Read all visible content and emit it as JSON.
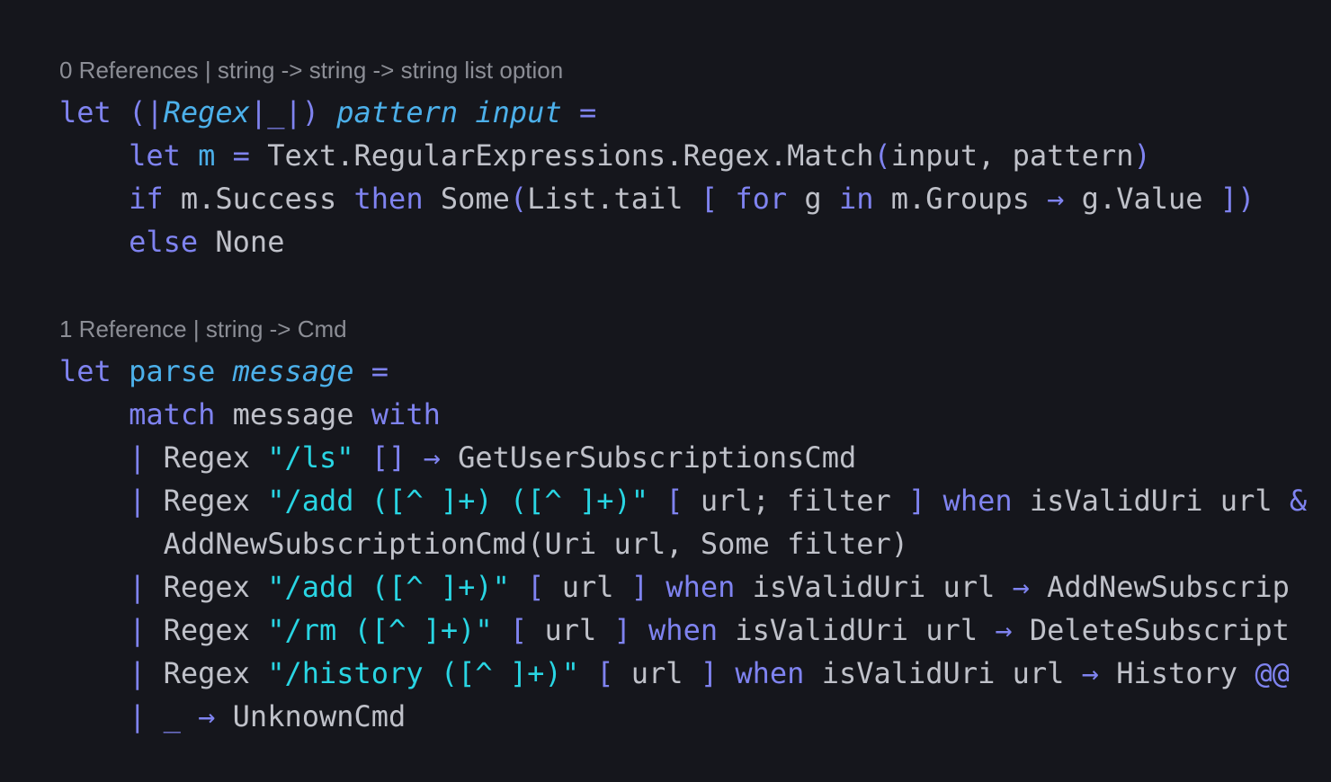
{
  "editor": {
    "code_lens": [
      "0 References | string -> string -> string list option",
      "1 Reference | string -> Cmd"
    ],
    "function1": {
      "line1": {
        "let": "let",
        "open": "(",
        "bar1": "|",
        "name": "Regex",
        "bar2": "|",
        "wild": "_",
        "bar3": "|",
        "close": ")",
        "p1": "pattern",
        "p2": "input",
        "eq": "="
      },
      "line2": {
        "let": "let",
        "var": "m",
        "eq": "=",
        "call": "Text.RegularExpressions.Regex.Match",
        "lp": "(",
        "args": "input, pattern",
        "rp": ")"
      },
      "line3": {
        "if": "if",
        "cond": "m.Success",
        "then": "then",
        "some": "Some",
        "lp": "(",
        "tail": "List.tail",
        "lb": "[",
        "for": "for",
        "g": "g",
        "in": "in",
        "groups": "m.Groups",
        "arrow": "→",
        "val": "g.Value",
        "rb": "]",
        "rp": ")"
      },
      "line4": {
        "else": "else",
        "none": "None"
      }
    },
    "function2": {
      "line1": {
        "let": "let",
        "name": "parse",
        "param": "message",
        "eq": "="
      },
      "line2": {
        "match": "match",
        "subject": "message",
        "with": "with"
      },
      "case1": {
        "pipe": "|",
        "ap": "Regex",
        "pattern": "\"/ls\"",
        "list": "[]",
        "arrow": "→",
        "result": "GetUserSubscriptionsCmd"
      },
      "case2": {
        "pipe": "|",
        "ap": "Regex",
        "pattern": "\"/add ([^ ]+) ([^ ]+)\"",
        "lb": "[",
        "vars": "url; filter",
        "rb": "]",
        "when": "when",
        "guard": "isValidUri url",
        "tail": "&"
      },
      "case2b": {
        "result": "AddNewSubscriptionCmd(Uri url, Some filter)"
      },
      "case3": {
        "pipe": "|",
        "ap": "Regex",
        "pattern": "\"/add ([^ ]+)\"",
        "lb": "[",
        "vars": "url",
        "rb": "]",
        "when": "when",
        "guard": "isValidUri url",
        "arrow": "→",
        "result": "AddNewSubscrip"
      },
      "case4": {
        "pipe": "|",
        "ap": "Regex",
        "pattern": "\"/rm ([^ ]+)\"",
        "lb": "[",
        "vars": "url",
        "rb": "]",
        "when": "when",
        "guard": "isValidUri url",
        "arrow": "→",
        "result": "DeleteSubscript"
      },
      "case5": {
        "pipe": "|",
        "ap": "Regex",
        "pattern": "\"/history ([^ ]+)\"",
        "lb": "[",
        "vars": "url",
        "rb": "]",
        "when": "when",
        "guard": "isValidUri url",
        "arrow": "→",
        "result": "History",
        "tail": "@@"
      },
      "case6": {
        "pipe": "|",
        "wild": "_",
        "arrow": "→",
        "result": "UnknownCmd"
      }
    }
  },
  "colors": {
    "background": "#15161c",
    "keyword": "#7f83f0",
    "function": "#4cb0ea",
    "string": "#29d5e3",
    "identifier": "#bfc1c9",
    "code_lens": "#8c8e96"
  }
}
